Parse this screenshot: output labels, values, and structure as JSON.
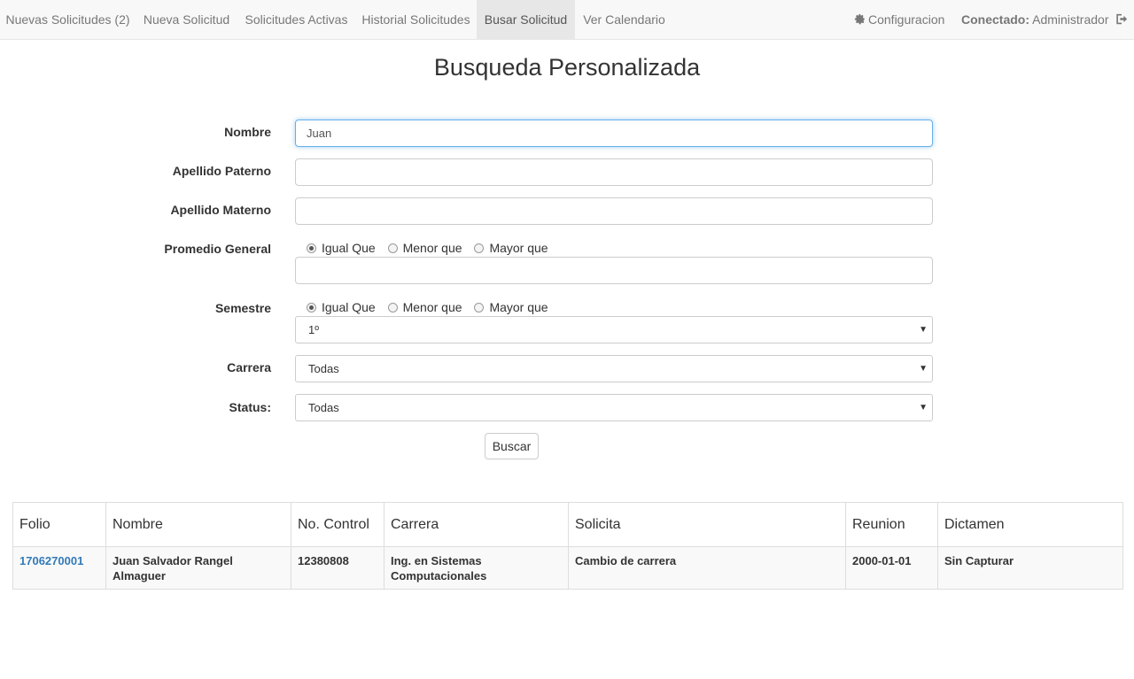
{
  "navbar": {
    "items": [
      {
        "label": "Nuevas Solicitudes (2)"
      },
      {
        "label": "Nueva Solicitud"
      },
      {
        "label": "Solicitudes Activas"
      },
      {
        "label": "Historial Solicitudes"
      },
      {
        "label": "Busar Solicitud",
        "active": true
      },
      {
        "label": "Ver Calendario"
      }
    ],
    "config_label": "Configuracion",
    "config_icon": "gear-icon",
    "connected_prefix": "Conectado:",
    "connected_user": "Administrador",
    "logout_icon": "sign-out-icon"
  },
  "page": {
    "title": "Busqueda Personalizada"
  },
  "form": {
    "nombre": {
      "label": "Nombre",
      "value": "Juan"
    },
    "apellido_paterno": {
      "label": "Apellido Paterno",
      "value": ""
    },
    "apellido_materno": {
      "label": "Apellido Materno",
      "value": ""
    },
    "promedio": {
      "label": "Promedio General",
      "options": [
        "Igual Que",
        "Menor que",
        "Mayor que"
      ],
      "selected": "Igual Que",
      "value": ""
    },
    "semestre": {
      "label": "Semestre",
      "options": [
        "Igual Que",
        "Menor que",
        "Mayor que"
      ],
      "selected": "Igual Que",
      "value": "1º"
    },
    "carrera": {
      "label": "Carrera",
      "value": "Todas"
    },
    "status": {
      "label": "Status:",
      "value": "Todas"
    },
    "submit_label": "Buscar"
  },
  "results": {
    "columns": [
      "Folio",
      "Nombre",
      "No. Control",
      "Carrera",
      "Solicita",
      "Reunion",
      "Dictamen"
    ],
    "rows": [
      {
        "folio": "1706270001",
        "nombre": "Juan Salvador Rangel Almaguer",
        "no_control": "12380808",
        "carrera": "Ing. en Sistemas Computacionales",
        "solicita": "Cambio de carrera",
        "reunion": "2000-01-01",
        "dictamen": "Sin Capturar"
      }
    ]
  },
  "colors": {
    "navbar_bg": "#f8f8f8",
    "nav_active_bg": "#e7e7e7",
    "link": "#337ab7",
    "focus_border": "#66afe9"
  }
}
